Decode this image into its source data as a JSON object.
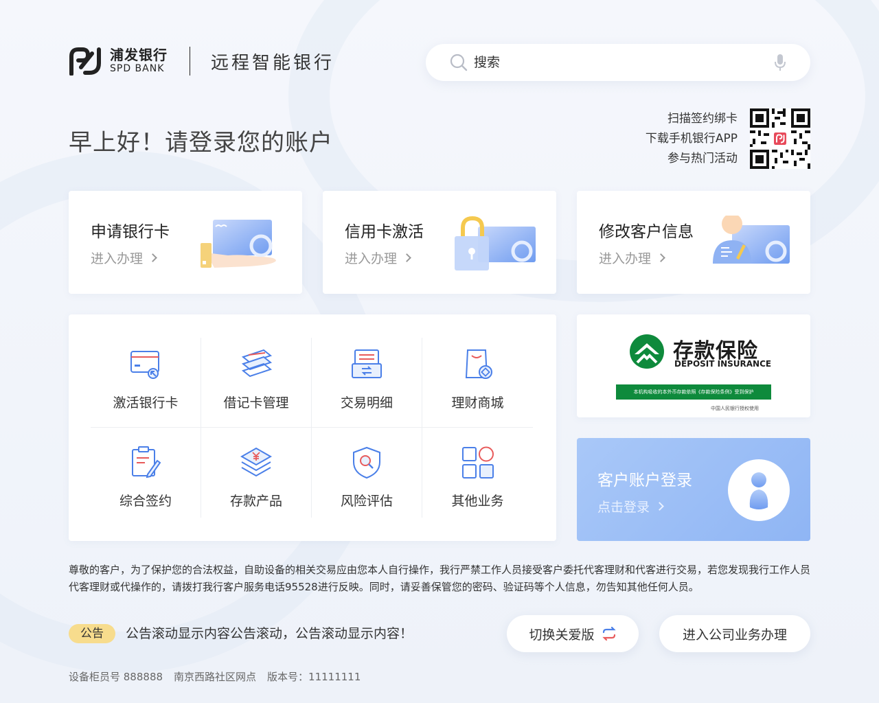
{
  "header": {
    "logo_cn": "浦发银行",
    "logo_en": "SPD BANK",
    "app_title": "远程智能银行",
    "search_placeholder": "搜索",
    "search_icon": "search-icon",
    "mic_icon": "microphone-icon"
  },
  "greeting": "早上好！请登录您的账户",
  "qr": {
    "lines": [
      "扫描签约绑卡",
      "下载手机银行APP",
      "参与热门活动"
    ]
  },
  "service_cards": [
    {
      "title": "申请银行卡",
      "link": "进入办理"
    },
    {
      "title": "信用卡激活",
      "link": "进入办理"
    },
    {
      "title": "修改客户信息",
      "link": "进入办理"
    }
  ],
  "grid_items": [
    {
      "label": "激活银行卡",
      "icon": "card-activate-icon"
    },
    {
      "label": "借记卡管理",
      "icon": "cards-stack-icon"
    },
    {
      "label": "交易明细",
      "icon": "transaction-icon"
    },
    {
      "label": "理财商城",
      "icon": "wealth-bag-icon"
    },
    {
      "label": "综合签约",
      "icon": "contract-sign-icon"
    },
    {
      "label": "存款产品",
      "icon": "deposit-layers-icon"
    },
    {
      "label": "风险评估",
      "icon": "risk-shield-icon"
    },
    {
      "label": "其他业务",
      "icon": "other-grid-icon"
    }
  ],
  "deposit_insurance": {
    "cn": "存款保险",
    "en": "DEPOSIT INSURANCE",
    "bar": "本机构吸收的本外币存款依照《存款保险条例》受到保护",
    "foot": "中国人民银行授权使用"
  },
  "login": {
    "title": "客户账户登录",
    "link": "点击登录"
  },
  "notice": "尊敬的客户，为了保护您的合法权益，自助设备的相关交易应由您本人自行操作，我行严禁工作人员接受客户委托代客理财和代客进行交易，若您发现我行工作人员代客理财或代操作的，请拨打我行客户服务电话95528进行反映。同时，请妥善保管您的密码、验证码等个人信息，勿告知其他任何人员。",
  "announcement": {
    "badge": "公告",
    "text": "公告滚动显示内容公告滚动，公告滚动显示内容！"
  },
  "buttons": {
    "care_mode": "切换关爱版",
    "business": "进入公司业务办理"
  },
  "footer": {
    "device": "设备柜员号 888888",
    "branch": "南京西路社区网点",
    "version": "版本号：11111111"
  },
  "colors": {
    "accent_blue": "#4a7fe8",
    "accent_red": "#e85a5a",
    "deposit_green": "#0e8a3c",
    "badge_yellow": "#f7dc8d"
  }
}
